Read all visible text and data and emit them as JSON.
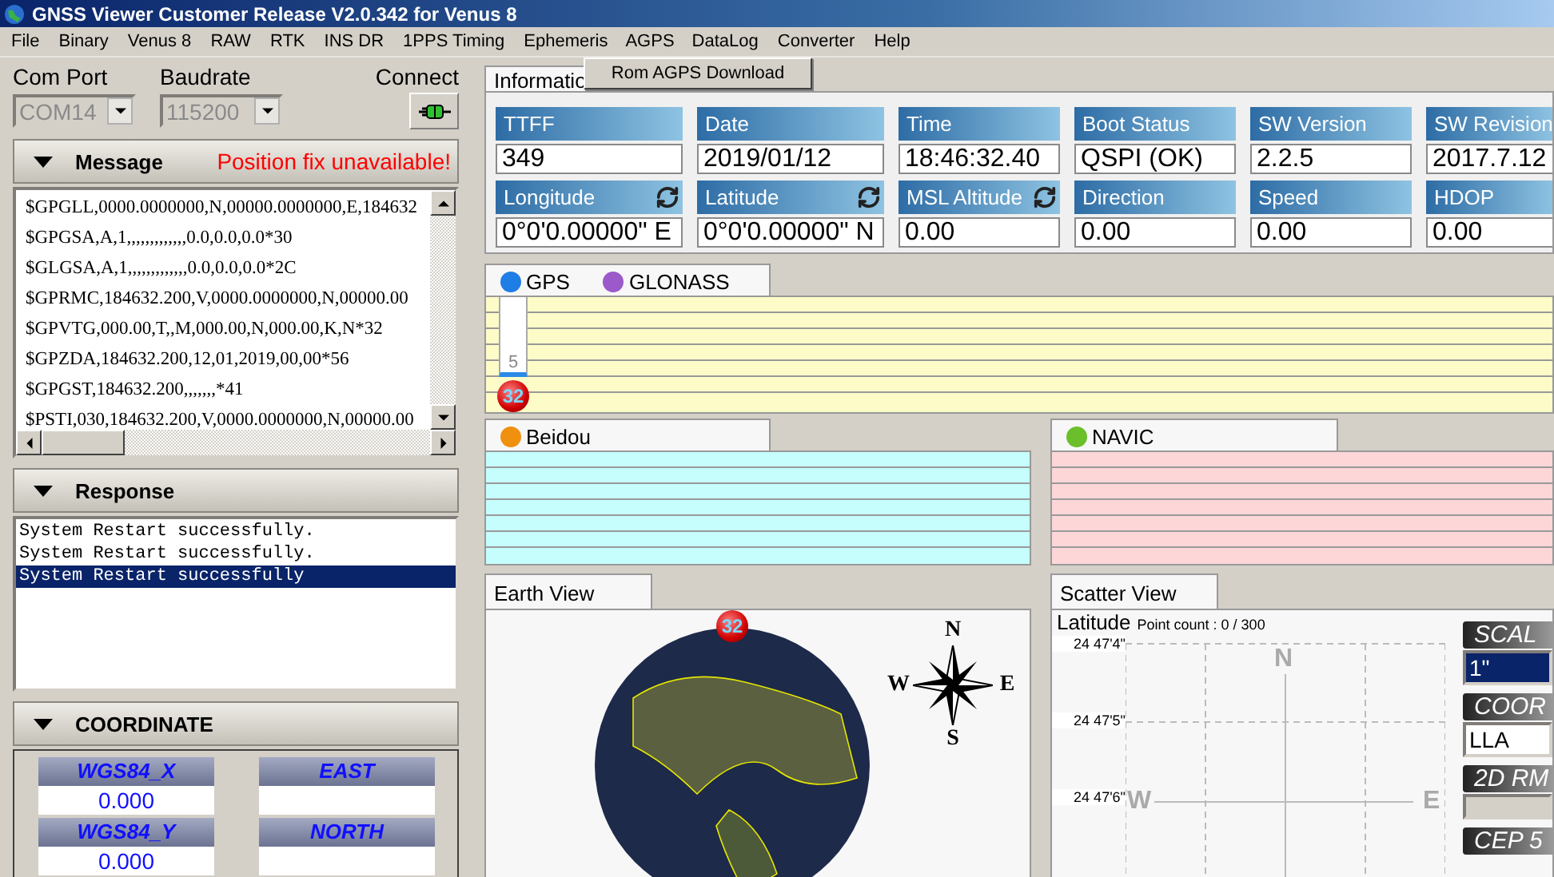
{
  "window": {
    "title": "GNSS Viewer Customer Release V2.0.342 for Venus 8"
  },
  "menu": [
    {
      "label": "File",
      "selected": false
    },
    {
      "label": "Binary",
      "selected": false
    },
    {
      "label": "Venus 8",
      "selected": false
    },
    {
      "label": "RAW",
      "selected": false
    },
    {
      "label": "RTK",
      "selected": false
    },
    {
      "label": "INS DR",
      "selected": false
    },
    {
      "label": "1PPS Timing",
      "selected": false
    },
    {
      "label": "Ephemeris",
      "selected": false
    },
    {
      "label": "AGPS",
      "selected": true
    },
    {
      "label": "DataLog",
      "selected": false
    },
    {
      "label": "Converter",
      "selected": false
    },
    {
      "label": "Help",
      "selected": false
    }
  ],
  "open_menu": {
    "items": [
      "Rom AGPS Download"
    ]
  },
  "connection": {
    "com_port_label": "Com Port",
    "com_port": "COM14",
    "baudrate_label": "Baudrate",
    "baudrate": "115200",
    "connect_label": "Connect",
    "disabled": true
  },
  "message": {
    "title": "Message",
    "status": "Position fix unavailable!",
    "lines": [
      "$GPGLL,0000.0000000,N,00000.0000000,E,184632",
      "$GPGSA,A,1,,,,,,,,,,,,,0.0,0.0,0.0*30",
      "$GLGSA,A,1,,,,,,,,,,,,,0.0,0.0,0.0*2C",
      "$GPRMC,184632.200,V,0000.0000000,N,00000.00",
      "$GPVTG,000.00,T,,M,000.00,N,000.00,K,N*32",
      "$GPZDA,184632.200,12,01,2019,00,00*56",
      "$GPGST,184632.200,,,,,,,*41",
      "$PSTI,030,184632.200,V,0000.0000000,N,00000.00"
    ]
  },
  "response": {
    "title": "Response",
    "lines": [
      {
        "text": "System Restart successfully.",
        "selected": false
      },
      {
        "text": "System Restart successfully.",
        "selected": false
      },
      {
        "text": "System Restart successfully",
        "selected": true
      }
    ]
  },
  "coordinate": {
    "title": "COORDINATE",
    "cells": [
      {
        "label": "WGS84_X",
        "value": "0.000"
      },
      {
        "label": "EAST"
      },
      {
        "label": "WGS84_Y",
        "value": "0.000"
      },
      {
        "label": "NORTH"
      }
    ]
  },
  "info_tab": {
    "label": "Informatio"
  },
  "info_fields": [
    {
      "label": "TTFF",
      "value": "349",
      "refresh": false
    },
    {
      "label": "Date",
      "value": "2019/01/12",
      "refresh": false
    },
    {
      "label": "Time",
      "value": "18:46:32.40",
      "refresh": false
    },
    {
      "label": "Boot  Status",
      "value": "QSPI (OK)",
      "refresh": false
    },
    {
      "label": "SW  Version",
      "value": "2.2.5",
      "refresh": false
    },
    {
      "label": "SW  Revision",
      "value": "2017.7.12",
      "refresh": false
    },
    {
      "label": "Longitude",
      "value": "0°0'0.00000\" E",
      "refresh": true
    },
    {
      "label": "Latitude",
      "value": "0°0'0.00000\" N",
      "refresh": true
    },
    {
      "label": "MSL Altitude",
      "value": "0.00",
      "refresh": true
    },
    {
      "label": "Direction",
      "value": "0.00",
      "refresh": false
    },
    {
      "label": "Speed",
      "value": "0.00",
      "refresh": false
    },
    {
      "label": "HDOP",
      "value": "0.00",
      "refresh": false
    }
  ],
  "gps_panel": {
    "systems": [
      {
        "name": "GPS",
        "color": "#1f7de6"
      },
      {
        "name": "GLONASS",
        "color": "#9b59c9"
      }
    ],
    "satellites": [
      {
        "prn": "32",
        "snr": "5"
      }
    ]
  },
  "beidou_panel": {
    "systems": [
      {
        "name": "Beidou",
        "color": "#f0900f"
      }
    ]
  },
  "navic_panel": {
    "systems": [
      {
        "name": "NAVIC",
        "color": "#6abf2a"
      }
    ]
  },
  "earth_view": {
    "title": "Earth View",
    "satellites": [
      {
        "prn": "32"
      }
    ],
    "compass": {
      "north": "N",
      "west": "W",
      "east": "E",
      "south": "S"
    }
  },
  "scatter_view": {
    "title": "Scatter View",
    "axis_label": "Latitude",
    "point_count": "Point count : 0 / 300",
    "y_ticks": [
      "24 47'4\"",
      "24 47'5\"",
      "24 47'6\""
    ],
    "directions": {
      "north": "N",
      "west": "W",
      "east": "E"
    },
    "controls": [
      {
        "kind": "select",
        "label": "SCAL",
        "value": "1\"",
        "selected": true
      },
      {
        "kind": "select",
        "label": "COOR",
        "value": "LLA",
        "selected": false
      },
      {
        "kind": "blank",
        "label": "2D RM"
      },
      {
        "kind": "header",
        "label": "CEP 5"
      }
    ]
  }
}
